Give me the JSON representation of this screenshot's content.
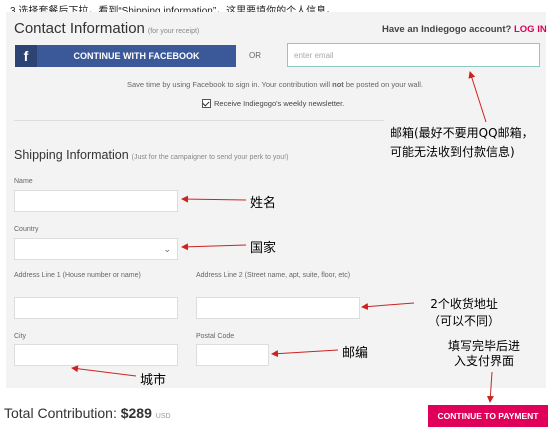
{
  "caption": "3.选择套餐后下拉，看到“Shipping information”，这里要填你的个人信息。",
  "contact": {
    "title": "Contact Information",
    "subtitle": "(for your receipt)",
    "account_question": "Have an Indiegogo account?",
    "login_label": "LOG IN",
    "facebook_button": "CONTINUE WITH FACEBOOK",
    "facebook_icon_glyph": "f",
    "or_label": "OR",
    "email_placeholder": "enter email",
    "email_value": "",
    "note_before": "Save time by using Facebook to sign in. Your contribution will ",
    "note_bold": "not",
    "note_after": " be posted on your wall.",
    "newsletter_label": "Receive Indiegogo's weekly newsletter.",
    "newsletter_checked": true
  },
  "shipping": {
    "title": "Shipping Information",
    "subtitle": "(Just for the campaigner to send your perk to you!)",
    "name_label": "Name",
    "country_label": "Country",
    "country_value": "",
    "address1_label": "Address Line 1 (House number or name)",
    "address2_label": "Address Line 2 (Street name, apt, suite, floor, etc)",
    "city_label": "City",
    "postal_label": "Postal Code"
  },
  "footer": {
    "total_label": "Total Contribution:",
    "total_amount": "$289",
    "currency": "USD",
    "pay_button": "CONTINUE TO PAYMENT"
  },
  "annotations": {
    "email_line1": "邮箱(最好不要用QQ邮箱，",
    "email_line2": "可能无法收到付款信息)",
    "name": "姓名",
    "country": "国家",
    "address_line1": "2个收货地址",
    "address_line2": "（可以不同）",
    "postal": "邮编",
    "city": "城市",
    "pay_line1": "填写完毕后进",
    "pay_line2": "入支付界面"
  },
  "colors": {
    "facebook": "#3b5998",
    "accent_pink": "#e0005a",
    "arrow_red": "#cc2222",
    "email_border": "#8fc7c1"
  }
}
